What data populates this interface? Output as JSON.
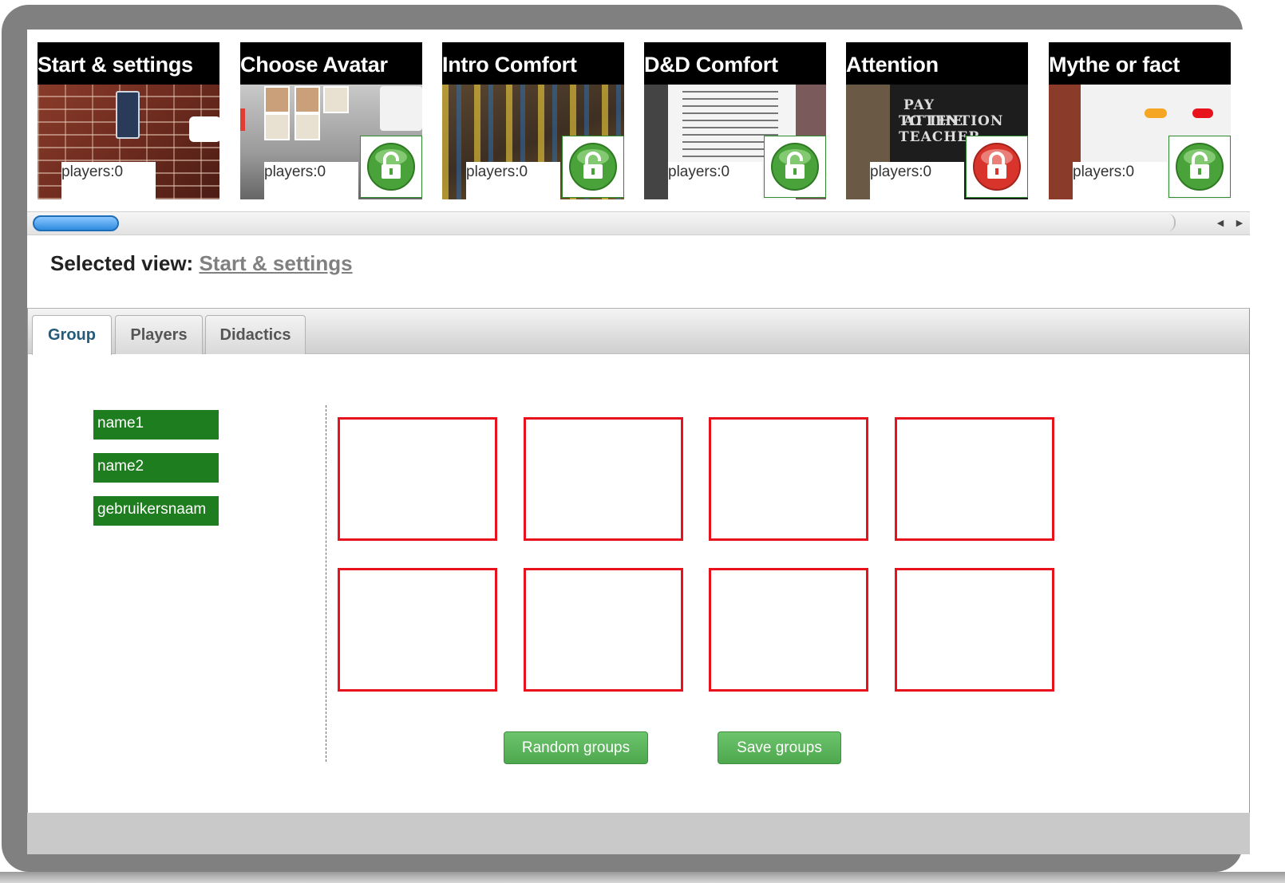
{
  "carousel": {
    "cards": [
      {
        "title": "Start & settings",
        "players": "players:0",
        "locked": null
      },
      {
        "title": "Choose Avatar",
        "players": "players:0",
        "locked": "unlocked"
      },
      {
        "title": "Intro Comfort",
        "players": "players:0",
        "locked": "unlocked"
      },
      {
        "title": "D&D Comfort",
        "players": "players:0",
        "locked": "unlocked"
      },
      {
        "title": "Attention",
        "players": "players:0",
        "locked": "locked"
      },
      {
        "title": "Mythe or fact",
        "players": "players:0",
        "locked": "unlocked"
      }
    ],
    "attention_thumb_text": [
      "PAY ATTENTION",
      "TO THE TEACHER"
    ]
  },
  "selected_view": {
    "label": "Selected view:",
    "value": "Start & settings"
  },
  "tabs": [
    {
      "label": "Group",
      "active": true
    },
    {
      "label": "Players",
      "active": false
    },
    {
      "label": "Didactics",
      "active": false
    }
  ],
  "names": [
    "name1",
    "name2",
    "gebruikersnaam"
  ],
  "group_box_count": 8,
  "buttons": {
    "random": "Random groups",
    "save": "Save groups"
  },
  "colors": {
    "name_chip": "#1e7d1e",
    "group_border": "#e8121d",
    "button": "#5cb85c",
    "lock_green": "#4aa33a",
    "lock_red": "#d9342b"
  }
}
